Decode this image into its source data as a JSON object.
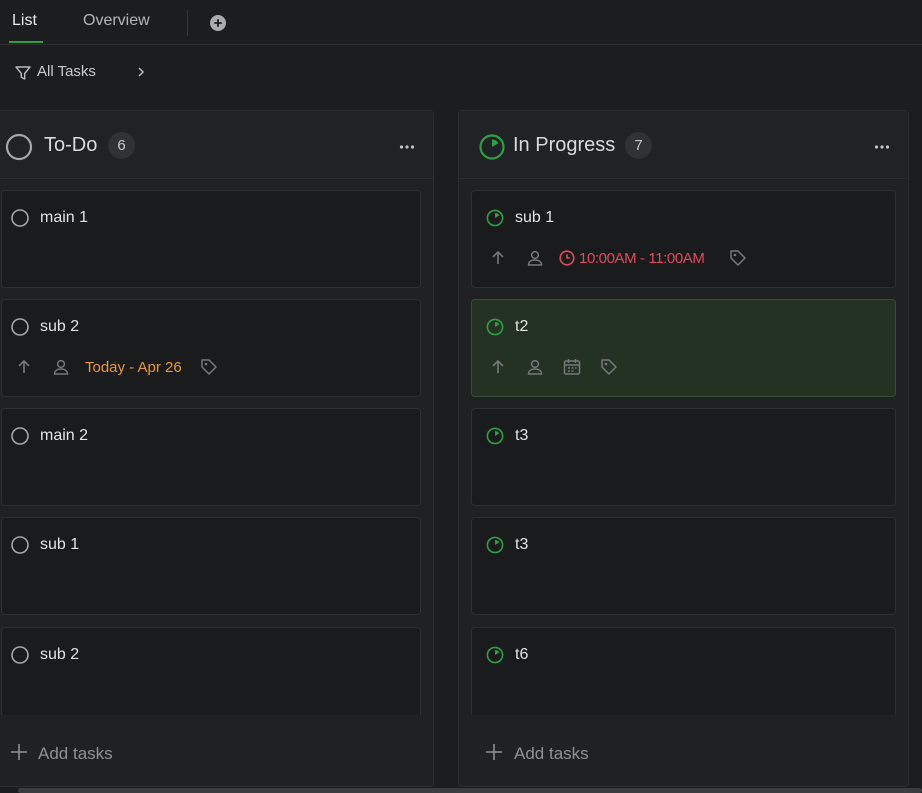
{
  "tabs": [
    {
      "label": "List",
      "active": true
    },
    {
      "label": "Overview",
      "active": false
    }
  ],
  "filter": {
    "label": "All Tasks"
  },
  "colors": {
    "accent": "#2f9e44",
    "date_orange": "#e8973a",
    "time_red": "#e0495b"
  },
  "columns": [
    {
      "title": "To-Do",
      "count": "6",
      "status_icon": "todo-circle-icon",
      "cards": [
        {
          "title": "main 1"
        },
        {
          "title": "sub 2",
          "date": "Today - Apr 26"
        },
        {
          "title": "main 2"
        },
        {
          "title": "sub 1"
        },
        {
          "title": "sub 2"
        }
      ],
      "add_label": "Add tasks"
    },
    {
      "title": "In Progress",
      "count": "7",
      "status_icon": "in-progress-icon",
      "cards": [
        {
          "title": "sub 1",
          "time": "10:00AM - 11:00AM"
        },
        {
          "title": "t2"
        },
        {
          "title": "t3"
        },
        {
          "title": "t3"
        },
        {
          "title": "t6"
        }
      ],
      "add_label": "Add tasks"
    }
  ]
}
